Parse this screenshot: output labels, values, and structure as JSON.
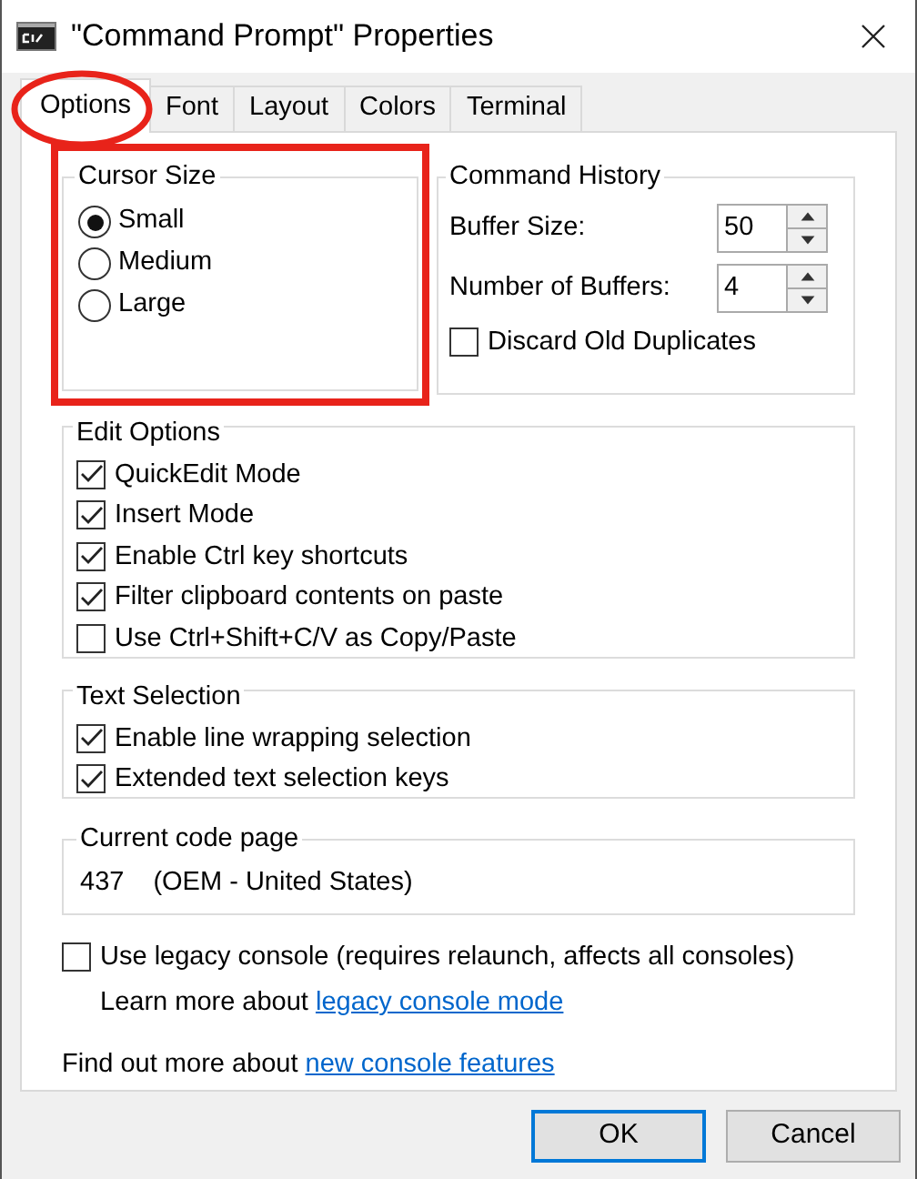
{
  "window": {
    "title": "\"Command Prompt\" Properties"
  },
  "tabs": [
    {
      "label": "Options",
      "selected": true
    },
    {
      "label": "Font",
      "selected": false
    },
    {
      "label": "Layout",
      "selected": false
    },
    {
      "label": "Colors",
      "selected": false
    },
    {
      "label": "Terminal",
      "selected": false
    }
  ],
  "cursor_size": {
    "title": "Cursor Size",
    "options": [
      {
        "label": "Small",
        "selected": true
      },
      {
        "label": "Medium",
        "selected": false
      },
      {
        "label": "Large",
        "selected": false
      }
    ]
  },
  "command_history": {
    "title": "Command History",
    "fields": [
      {
        "label": "Buffer Size:",
        "value": "50"
      },
      {
        "label": "Number of Buffers:",
        "value": "4"
      }
    ],
    "discard": {
      "label": "Discard Old Duplicates",
      "checked": false
    }
  },
  "edit_options": {
    "title": "Edit Options",
    "items": [
      {
        "label": "QuickEdit Mode",
        "checked": true
      },
      {
        "label": "Insert Mode",
        "checked": true
      },
      {
        "label": "Enable Ctrl key shortcuts",
        "checked": true
      },
      {
        "label": "Filter clipboard contents on paste",
        "checked": true
      },
      {
        "label": "Use Ctrl+Shift+C/V as Copy/Paste",
        "checked": false
      }
    ]
  },
  "text_selection": {
    "title": "Text Selection",
    "items": [
      {
        "label": "Enable line wrapping selection",
        "checked": true
      },
      {
        "label": "Extended text selection keys",
        "checked": true
      }
    ]
  },
  "code_page": {
    "title": "Current code page",
    "code": "437",
    "name": "(OEM - United States)"
  },
  "legacy_console": {
    "label": "Use legacy console (requires relaunch, affects all consoles)",
    "checked": false
  },
  "learn_more": {
    "text": "Learn more about",
    "link": "legacy console mode"
  },
  "find_out": {
    "text": "Find out more about",
    "link": "new console features"
  },
  "buttons": [
    {
      "label": "OK",
      "default": true
    },
    {
      "label": "Cancel",
      "default": false
    }
  ]
}
